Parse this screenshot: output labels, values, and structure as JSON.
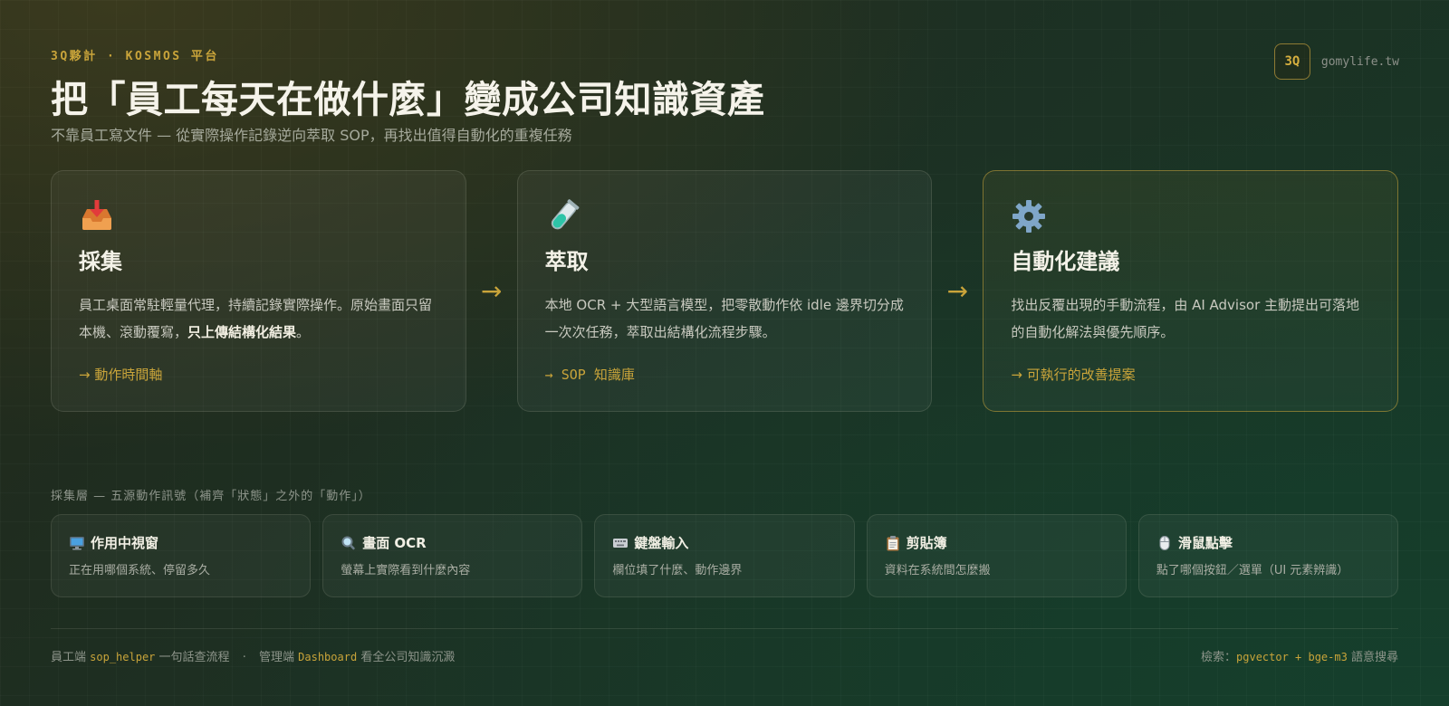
{
  "header": {
    "eyebrow": "3Q夥計 · KOSMOS 平台",
    "title": "把「員工每天在做什麼」變成公司知識資產",
    "subtitle": "不靠員工寫文件 — 從實際操作記錄逆向萃取 SOP，再找出值得自動化的重複任務"
  },
  "brand": {
    "badge": "3Q",
    "domain": "gomylife.tw"
  },
  "pipeline": {
    "arrow": "→",
    "cards": [
      {
        "icon": "inbox-tray-icon",
        "title": "採集",
        "desc_1": "員工桌面常駐輕量代理，持續記錄實際操作。原始畫面只留本機、滾動覆寫，",
        "desc_bold": "只上傳結構化結果",
        "desc_2": "。",
        "footer": "→ 動作時間軸"
      },
      {
        "icon": "test-tube-icon",
        "title": "萃取",
        "desc_1": "本地 OCR + 大型語言模型，把零散動作依 idle 邊界切分成一次次任務，萃取出結構化流程步驟。",
        "footer": "→ SOP 知識庫"
      },
      {
        "icon": "gear-icon",
        "title": "自動化建議",
        "desc_1": "找出反覆出現的手動流程，由 AI Advisor 主動提出可落地的自動化解法與優先順序。",
        "footer": "→ 可執行的改善提案"
      }
    ]
  },
  "sources": {
    "label": "採集層 — 五源動作訊號（補齊「狀態」之外的「動作」）",
    "items": [
      {
        "icon": "desktop-computer-icon",
        "title": "作用中視窗",
        "desc": "正在用哪個系統、停留多久"
      },
      {
        "icon": "magnifier-icon",
        "title": "畫面 OCR",
        "desc": "螢幕上實際看到什麼內容"
      },
      {
        "icon": "keyboard-icon",
        "title": "鍵盤輸入",
        "desc": "欄位填了什麼、動作邊界"
      },
      {
        "icon": "clipboard-icon",
        "title": "剪貼簿",
        "desc": "資料在系統間怎麼搬"
      },
      {
        "icon": "mouse-icon",
        "title": "滑鼠點擊",
        "desc": "點了哪個按鈕／選單（UI 元素辨識）"
      }
    ]
  },
  "footer": {
    "left_1": "員工端",
    "left_code_1": "sop_helper",
    "left_2": "一句話查流程",
    "sep": "·",
    "left_3": "管理端",
    "left_code_2": "Dashboard",
    "left_4": "看全公司知識沉澱",
    "right_1": "檢索：",
    "right_code": "pgvector + bge-m3",
    "right_2": "語意搜尋"
  },
  "colors": {
    "accent": "#c9a43a",
    "text": "#e8e6dc",
    "muted": "#a6aa9c"
  }
}
